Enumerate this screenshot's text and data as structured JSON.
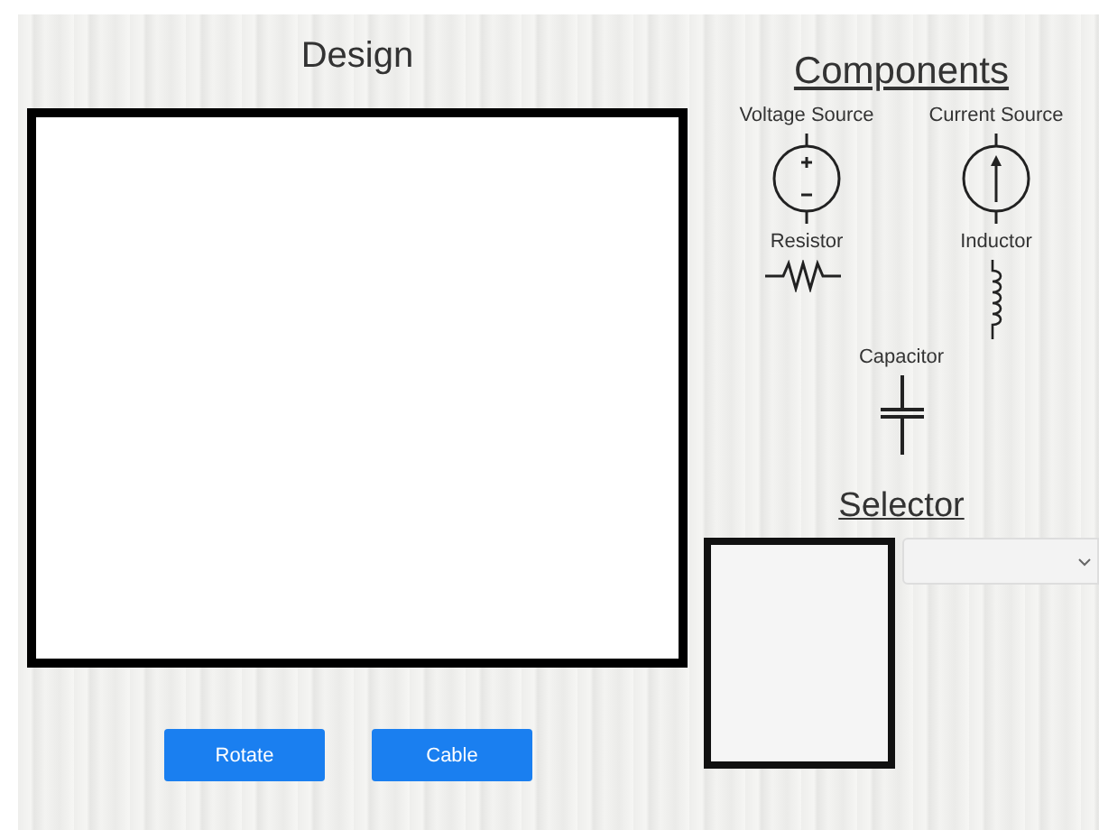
{
  "design": {
    "title": "Design"
  },
  "buttons": [
    {
      "label": "Rotate"
    },
    {
      "label": "Cable"
    }
  ],
  "components": {
    "title": "Components",
    "items": [
      {
        "label": "Voltage Source",
        "kind": "voltage"
      },
      {
        "label": "Current Source",
        "kind": "current"
      },
      {
        "label": "Resistor",
        "kind": "resistor"
      },
      {
        "label": "Inductor",
        "kind": "inductor"
      },
      {
        "label": "Capacitor",
        "kind": "capacitor"
      }
    ]
  },
  "selector": {
    "title": "Selector"
  }
}
